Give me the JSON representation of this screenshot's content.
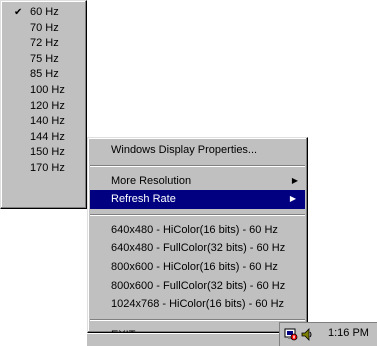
{
  "refresh_submenu": {
    "items": [
      {
        "label": "60 Hz",
        "checked": true
      },
      {
        "label": "70 Hz"
      },
      {
        "label": "72 Hz"
      },
      {
        "label": "75 Hz"
      },
      {
        "label": "85 Hz"
      },
      {
        "label": "100 Hz"
      },
      {
        "label": "120 Hz"
      },
      {
        "label": "140 Hz"
      },
      {
        "label": "144 Hz"
      },
      {
        "label": "150 Hz"
      },
      {
        "label": "170 Hz"
      }
    ],
    "check_glyph": "✔"
  },
  "context_menu": {
    "display_properties": "Windows Display Properties...",
    "more_resolution": "More Resolution",
    "refresh_rate": "Refresh Rate",
    "arrow_glyph": "▶",
    "modes": [
      "640x480 - HiColor(16 bits) - 60 Hz",
      "640x480 - FullColor(32 bits) - 60 Hz",
      "800x600 - HiColor(16 bits) - 60 Hz",
      "800x600 - FullColor(32 bits) - 60 Hz",
      "1024x768 - HiColor(16 bits) - 60 Hz"
    ],
    "exit": "EXIT",
    "highlight_color": "#000080"
  },
  "tray": {
    "clock": "1:16 PM",
    "icons": [
      "display-settings-icon",
      "speaker-icon"
    ]
  }
}
